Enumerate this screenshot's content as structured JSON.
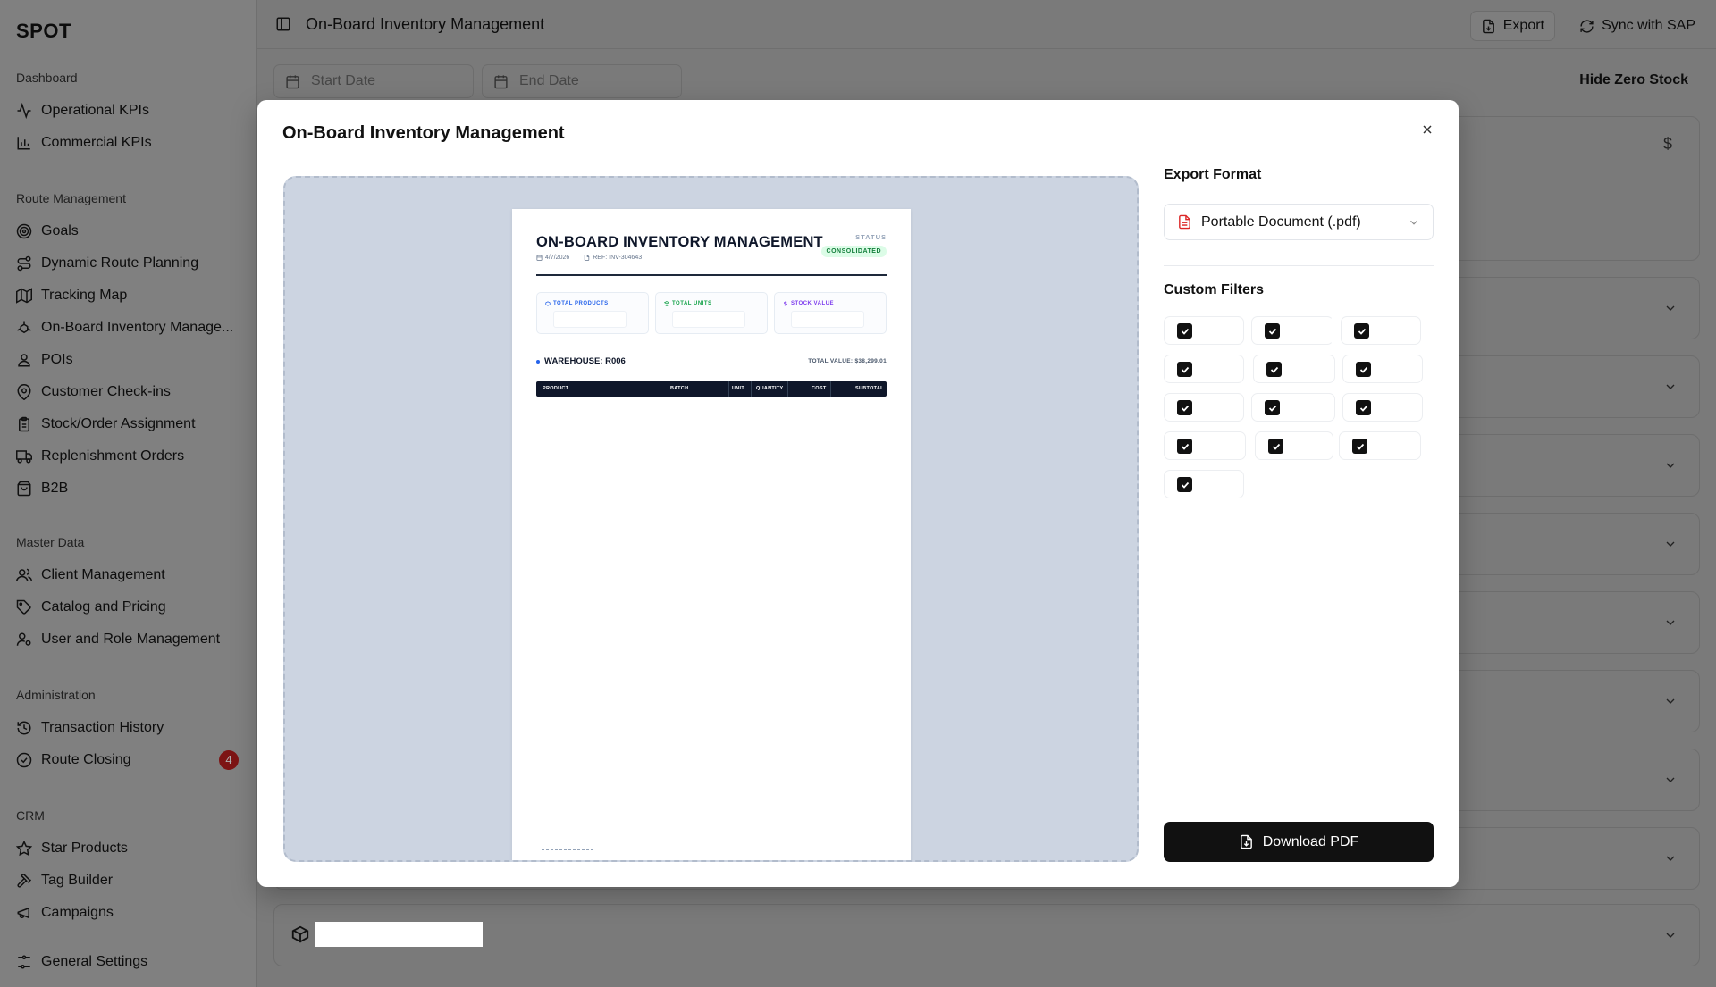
{
  "app": {
    "brand": "SPOT",
    "page_title": "On-Board Inventory Management"
  },
  "sidebar": {
    "sections": [
      {
        "title": "Dashboard",
        "items": [
          {
            "label": "Operational KPIs",
            "icon": "activity-icon"
          },
          {
            "label": "Commercial KPIs",
            "icon": "bar-chart-icon"
          }
        ]
      },
      {
        "title": "Route Management",
        "items": [
          {
            "label": "Goals",
            "icon": "target-icon"
          },
          {
            "label": "Dynamic Route Planning",
            "icon": "route-icon"
          },
          {
            "label": "Tracking Map",
            "icon": "map-icon"
          },
          {
            "label": "On-Board Inventory Manage...",
            "icon": "boxes-icon"
          },
          {
            "label": "POIs",
            "icon": "user-pin-icon"
          },
          {
            "label": "Customer Check-ins",
            "icon": "map-pin-icon"
          },
          {
            "label": "Stock/Order Assignment",
            "icon": "clipboard-icon"
          },
          {
            "label": "Replenishment Orders",
            "icon": "truck-icon"
          },
          {
            "label": "B2B",
            "icon": "shopping-bag-icon"
          }
        ]
      },
      {
        "title": "Master Data",
        "items": [
          {
            "label": "Client Management",
            "icon": "users-icon"
          },
          {
            "label": "Catalog and Pricing",
            "icon": "tag-icon"
          },
          {
            "label": "User and Role Management",
            "icon": "user-cog-icon"
          }
        ]
      },
      {
        "title": "Administration",
        "items": [
          {
            "label": "Transaction History",
            "icon": "history-icon"
          },
          {
            "label": "Route Closing",
            "icon": "check-circle-icon",
            "badge": "4"
          }
        ]
      },
      {
        "title": "CRM",
        "items": [
          {
            "label": "Star Products",
            "icon": "star-icon"
          },
          {
            "label": "Tag Builder",
            "icon": "hammer-icon"
          },
          {
            "label": "Campaigns",
            "icon": "megaphone-icon"
          }
        ]
      }
    ],
    "footer_item": {
      "label": "General Settings",
      "icon": "sliders-icon"
    }
  },
  "toolbar": {
    "export_label": "Export",
    "sync_label": "Sync with SAP"
  },
  "filters": {
    "start_date_placeholder": "Start Date",
    "end_date_placeholder": "End Date",
    "hide_zero_label": "Hide Zero Stock"
  },
  "background": {
    "currency_symbol": "$"
  },
  "modal": {
    "title": "On-Board Inventory Management",
    "export_format_label": "Export Format",
    "export_format_value": "Portable Document (.pdf)",
    "custom_filters_label": "Custom Filters",
    "filters_checked": [
      true,
      true,
      true,
      true,
      true,
      true,
      true,
      true,
      true,
      true,
      true,
      true,
      true
    ],
    "download_label": "Download PDF"
  },
  "document_preview": {
    "title": "ON-BOARD INVENTORY MANAGEMENT",
    "date": "4/7/2026",
    "ref": "REF: INV-304643",
    "status_label": "STATUS",
    "status_value": "CONSOLIDATED",
    "kpis": [
      {
        "label": "TOTAL PRODUCTS",
        "color": "#2563eb"
      },
      {
        "label": "TOTAL UNITS",
        "color": "#16a34a"
      },
      {
        "label": "STOCK VALUE",
        "color": "#7c3aed"
      }
    ],
    "warehouse": "WAREHOUSE: R006",
    "total_value": "TOTAL VALUE: $38,299.01",
    "columns": [
      "PRODUCT",
      "BATCH",
      "UNIT",
      "QUANTITY",
      "COST",
      "SUBTOTAL"
    ]
  }
}
